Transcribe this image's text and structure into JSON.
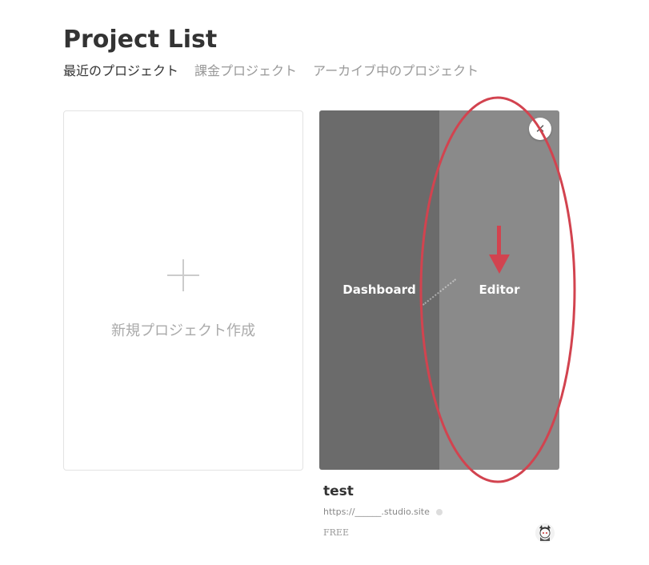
{
  "header": {
    "title": "Project List"
  },
  "tabs": [
    {
      "label": "最近のプロジェクト",
      "active": true
    },
    {
      "label": "課金プロジェクト",
      "active": false
    },
    {
      "label": "アーカイブ中のプロジェクト",
      "active": false
    }
  ],
  "new_project_card": {
    "icon": "plus-icon",
    "label": "新規プロジェクト作成"
  },
  "project": {
    "dashboard_label": "Dashboard",
    "editor_label": "Editor",
    "name": "test",
    "url": "https://______.studio.site",
    "plan": "FREE",
    "close_icon": "close-icon",
    "colors": {
      "dashboard_pane": "#6b6b6b",
      "editor_pane": "#8a8a8a"
    }
  },
  "annotation": {
    "color": "#d2434f",
    "shapes": [
      "ellipse-highlight",
      "down-arrow"
    ]
  }
}
